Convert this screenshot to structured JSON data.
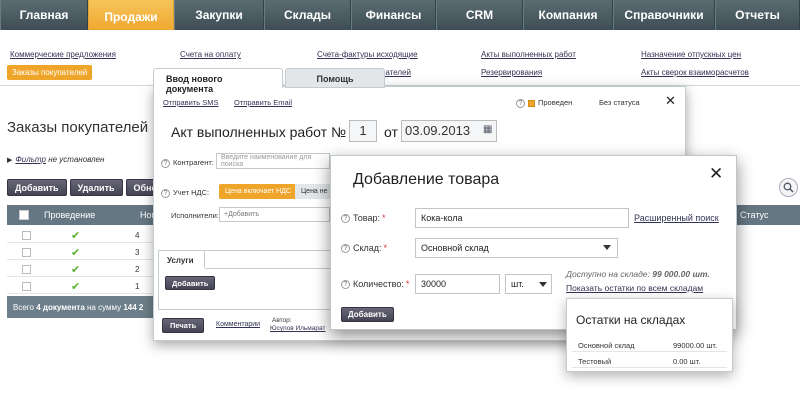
{
  "nav": {
    "items": [
      {
        "label": "Главная"
      },
      {
        "label": "Продажи",
        "active": true
      },
      {
        "label": "Закупки"
      },
      {
        "label": "Склады"
      },
      {
        "label": "Финансы"
      },
      {
        "label": "CRM"
      },
      {
        "label": "Компания"
      },
      {
        "label": "Справочники"
      },
      {
        "label": "Отчеты"
      }
    ]
  },
  "submenu": {
    "commercial_offers": "Коммерческие предложения",
    "customer_orders": "Заказы покупателей",
    "invoices": "Счета на оплату",
    "outgoing_invoices": "Счета-фактуры исходящие",
    "outgoing_invoices_cut": "пателей",
    "completed_works": "Акты выполненных работ",
    "reservations": "Резервирования",
    "release_prices": "Назначение отпускных цен",
    "reconciliation": "Акты сверок взаиморасчетов"
  },
  "page": {
    "title": "Заказы покупателей",
    "filter_link": "Фильтр",
    "filter_text": "не установлен",
    "add_button": "Добавить",
    "delete_button": "Удалить",
    "refresh_button": "Обно",
    "columns": {
      "conducted": "Проведение",
      "number": "Ном",
      "status": "Статус"
    },
    "rows": [
      {
        "number": "4"
      },
      {
        "number": "3"
      },
      {
        "number": "2"
      },
      {
        "number": "1"
      }
    ],
    "footer_prefix": "Всего",
    "footer_count": "4 документа",
    "footer_mid": "на сумму",
    "footer_sum": "144 2"
  },
  "doc_modal": {
    "tab_new": "Ввод нового документа",
    "tab_help": "Помощь",
    "send_sms": "Отправить SMS",
    "send_email": "Отправить Email",
    "conducted": "Проведен",
    "no_status": "Без статуса",
    "doc_type": "Акт выполненных работ",
    "number_label": "№",
    "number_value": "1",
    "date_label": "от",
    "date_value": "03.09.2013",
    "contractor_label": "Контрагент:",
    "contractor_placeholder": "Введите наименование для поиска",
    "vat_label": "Учет НДС:",
    "vat_included": "Цена включает НДС",
    "vat_excluded": "Цена не",
    "performers_label": "Исполнители:",
    "performers_add": "Добавить",
    "services_tab": "Услуги",
    "services_add": "Добавить",
    "print_button": "Печать",
    "comments_link": "Комментарии",
    "author_label": "Автор:",
    "author_name": "Юсупов Ильмарат"
  },
  "add_dialog": {
    "title": "Добавление товара",
    "product_label": "Товар:",
    "product_value": "Кока-кола",
    "advanced_search": "Расширенный поиск",
    "warehouse_label": "Склад:",
    "warehouse_value": "Основной склад",
    "quantity_label": "Количество:",
    "quantity_value": "30000",
    "unit_value": "шт.",
    "available_text": "Доступно на складе:",
    "available_value": "99 000.00 шт.",
    "show_stock_link": "Показать остатки по всем складам",
    "add_button": "Добавить"
  },
  "stock_panel": {
    "title": "Остатки на складах",
    "rows": [
      {
        "name": "Основной склад",
        "value": "99000.00 шт."
      },
      {
        "name": "Тестовый",
        "value": "0.00 шт."
      }
    ]
  },
  "colors": {
    "accent": "#eea52a",
    "nav_bg": "#4a5a61",
    "check": "#5ab02f"
  }
}
